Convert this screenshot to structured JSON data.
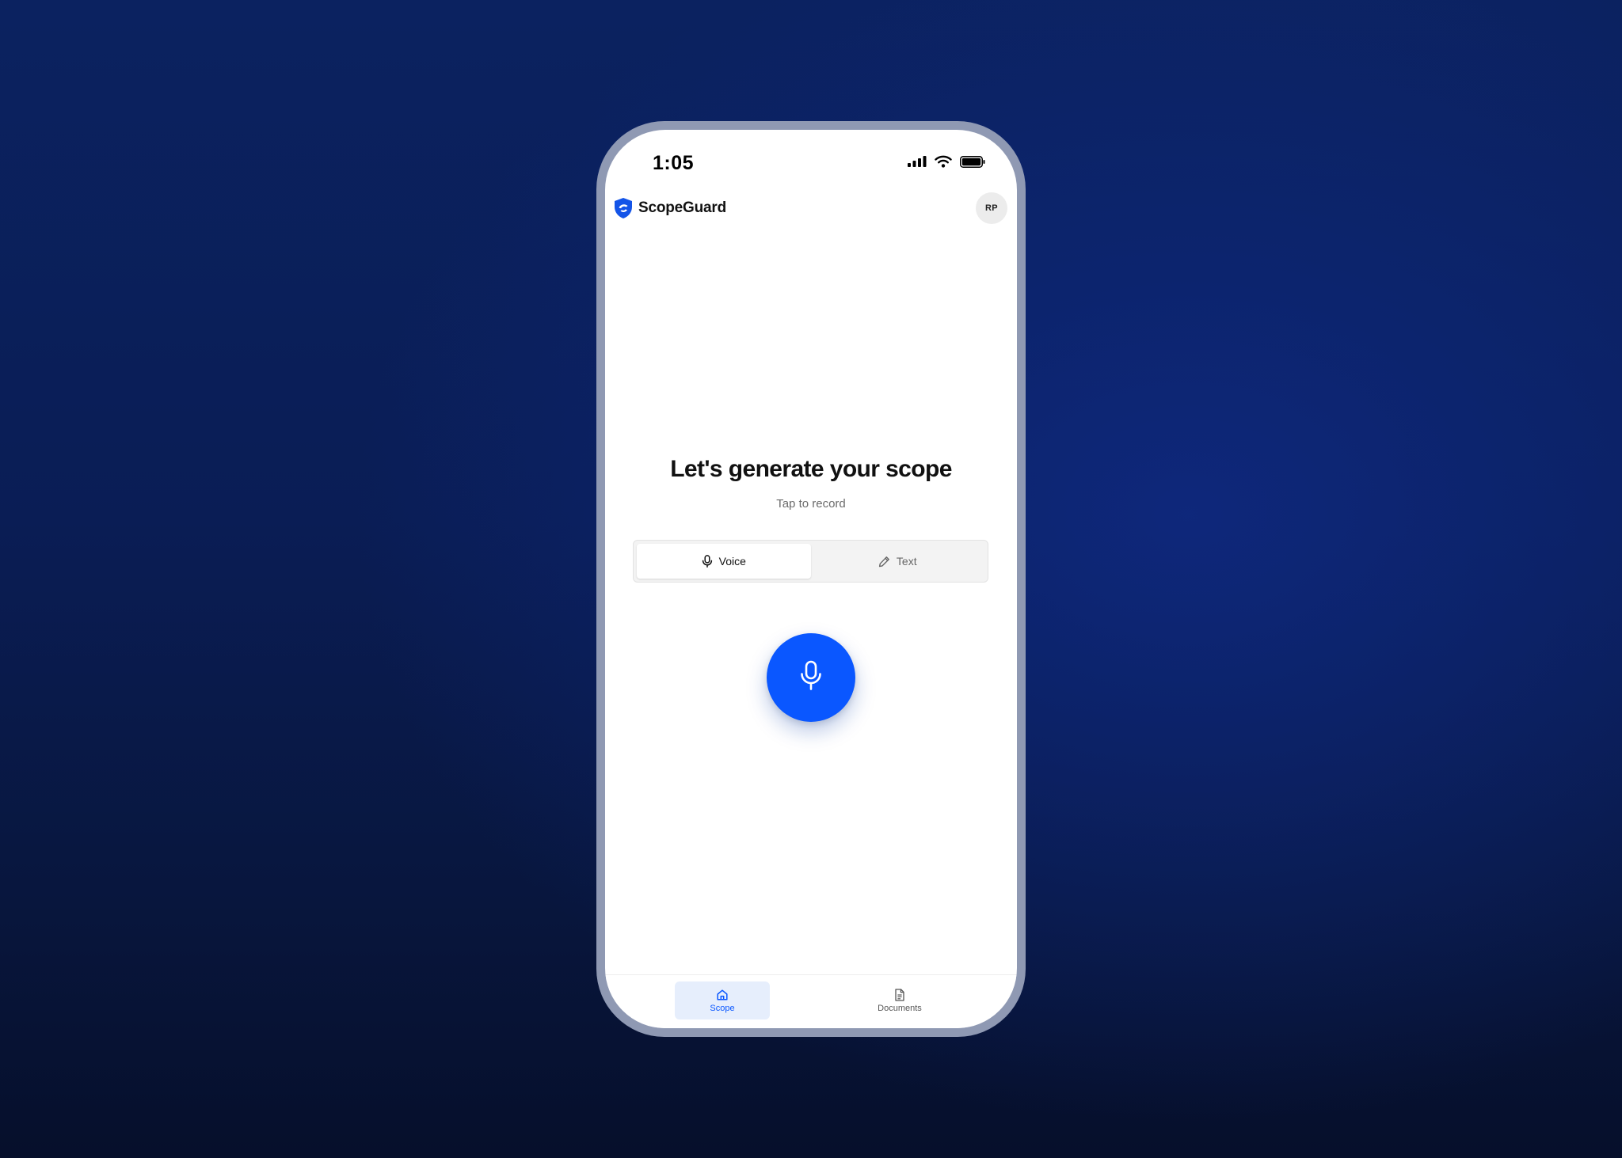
{
  "status_bar": {
    "time": "1:05",
    "signal_icon": "cellular-signal-icon",
    "wifi_icon": "wifi-icon",
    "battery_icon": "battery-icon"
  },
  "header": {
    "logo_icon": "shield-logo-icon",
    "app_name": "ScopeGuard",
    "avatar_initials": "RP"
  },
  "main": {
    "headline": "Let's generate your scope",
    "subtitle": "Tap to record",
    "modes": [
      {
        "label": "Voice",
        "icon": "microphone-icon",
        "selected": true
      },
      {
        "label": "Text",
        "icon": "pencil-icon",
        "selected": false
      }
    ],
    "record_button_icon": "microphone-icon"
  },
  "bottom_nav": {
    "tabs": [
      {
        "label": "Scope",
        "icon": "home-icon",
        "active": true
      },
      {
        "label": "Documents",
        "icon": "document-icon",
        "active": false
      }
    ]
  },
  "colors": {
    "accent": "#0a57ff",
    "active_tab_background": "#e6eefc",
    "phone_frame": "#8f99b3",
    "backdrop": "#0b2260"
  }
}
